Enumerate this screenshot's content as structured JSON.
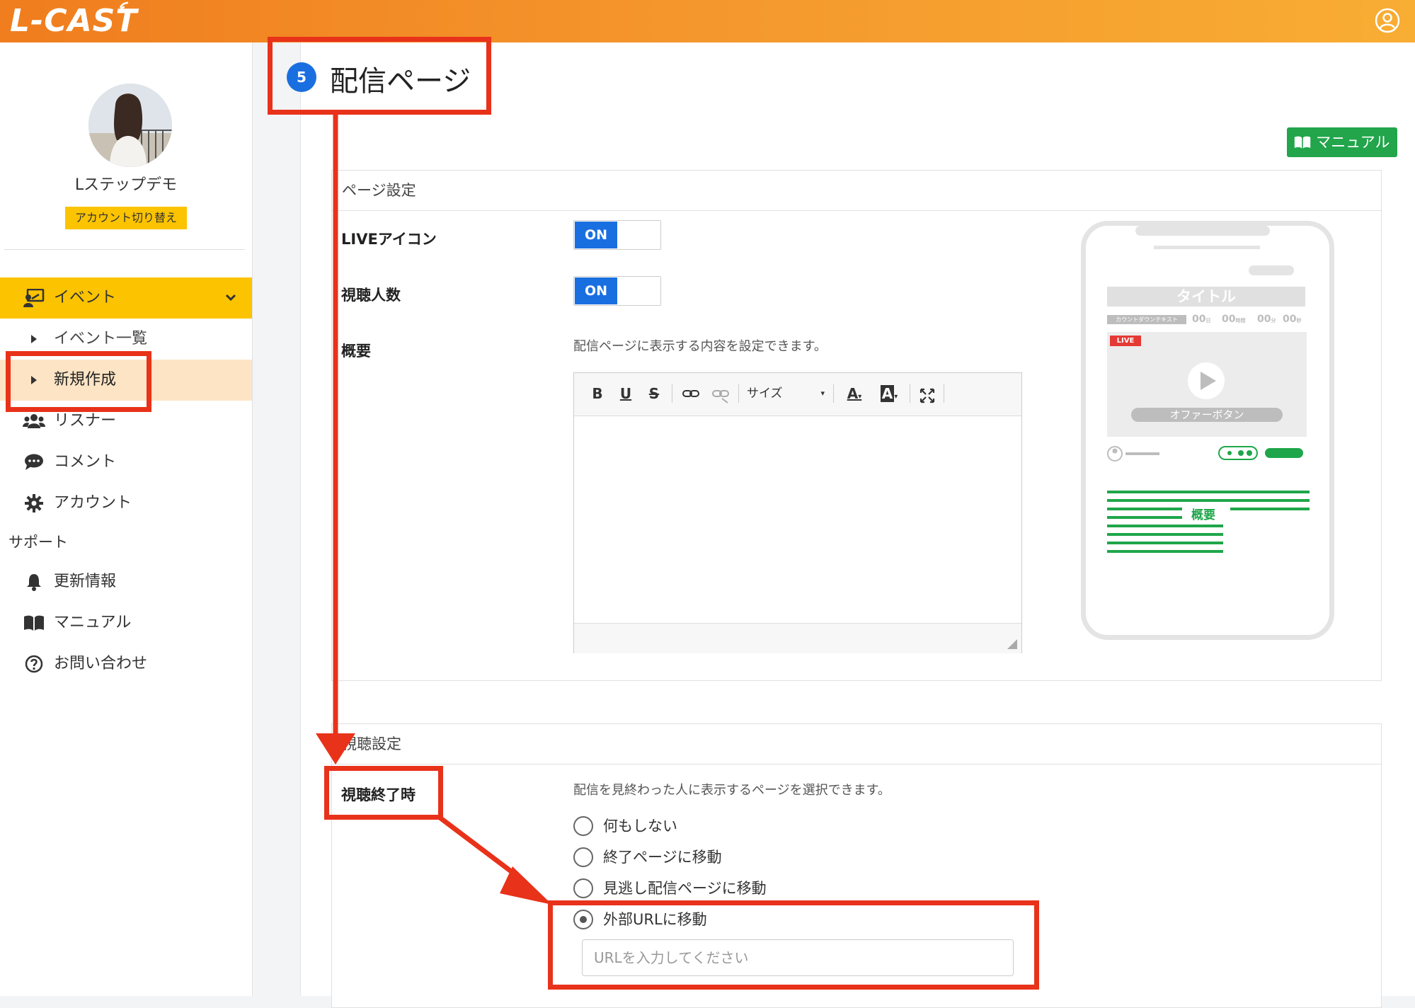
{
  "app": {
    "logo": "L-CAST"
  },
  "sidebar": {
    "account_name": "Lステップデモ",
    "switch_account": "アカウント切り替え",
    "nav": {
      "events": "イベント",
      "events_list": "イベント一覧",
      "new": "新規作成",
      "listener": "リスナー",
      "comment": "コメント",
      "account": "アカウント"
    },
    "support_label": "サポート",
    "support": {
      "updates": "更新情報",
      "manual": "マニュアル",
      "contact": "お問い合わせ"
    }
  },
  "main": {
    "step_number": "5",
    "page_title": "配信ページ",
    "manual_button": "マニュアル",
    "page_settings": {
      "header": "ページ設定",
      "live_icon_label": "LIVEアイコン",
      "live_icon_state": "ON",
      "viewers_label": "視聴人数",
      "viewers_state": "ON",
      "summary_label": "概要",
      "summary_help": "配信ページに表示する内容を設定できます。",
      "editor": {
        "bold": "B",
        "underline": "U",
        "strike": "S",
        "size_label": "サイズ",
        "font_color": "A",
        "highlight": "A"
      }
    },
    "preview": {
      "title": "タイトル",
      "countdown_text": "カウントダウンテキスト",
      "countdown_values": [
        "00",
        "00",
        "00",
        "00"
      ],
      "countdown_units": [
        "日",
        "時間",
        "分",
        "秒"
      ],
      "live_badge": "LIVE",
      "offer_button": "オファーボタン",
      "summary": "概要"
    },
    "view_settings": {
      "header": "視聴設定",
      "end_label": "視聴終了時",
      "end_help": "配信を見終わった人に表示するページを選択できます。",
      "options": [
        "何もしない",
        "終了ページに移動",
        "見逃し配信ページに移動",
        "外部URLに移動"
      ],
      "selected_option": "外部URLに移動",
      "url_placeholder": "URLを入力してください"
    }
  },
  "colors": {
    "header_gradient_start": "#f07d1e",
    "header_gradient_end": "#f8ad33",
    "sidebar_active": "#fbc300",
    "sidebar_selected": "#fde4c4",
    "primary": "#1a6fe0",
    "manual_button": "#22a54b",
    "annotation_red": "#e8321a",
    "preview_green": "#1fa64a"
  }
}
